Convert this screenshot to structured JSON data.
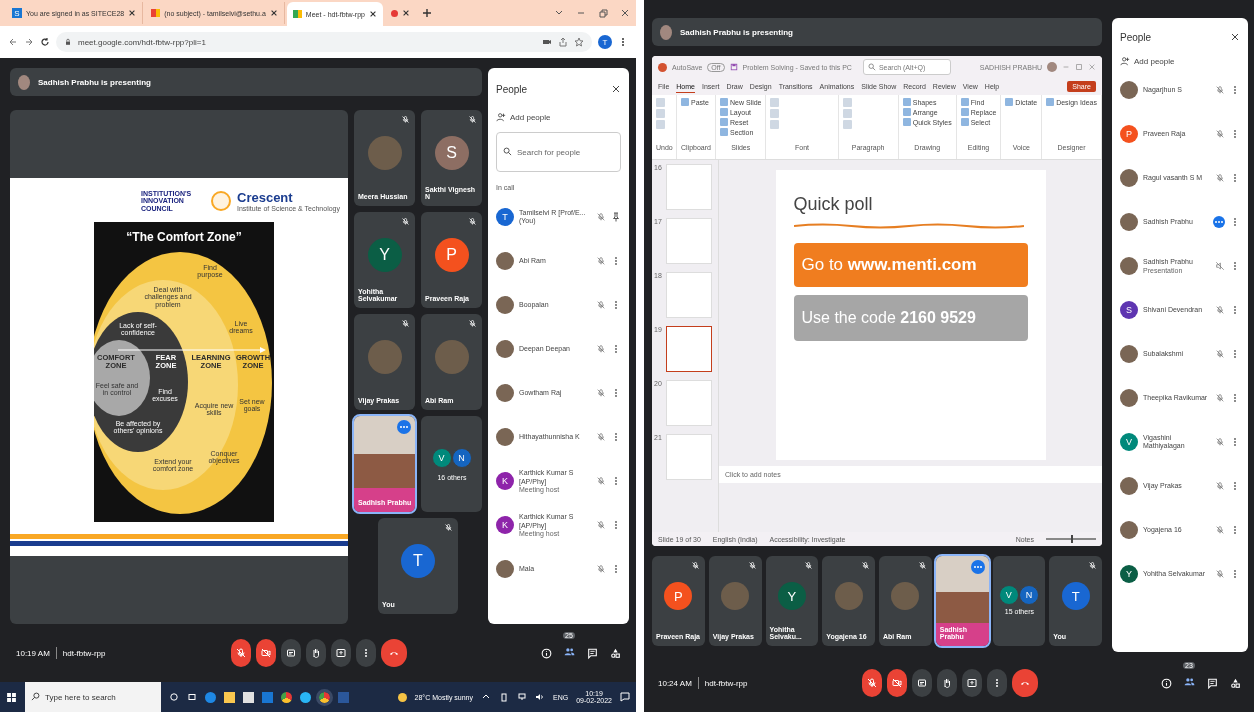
{
  "left": {
    "browser": {
      "tabs": [
        {
          "title": "You are signed in as SITECE28",
          "favicon": "S",
          "selected": false
        },
        {
          "title": "(no subject) - tamilselvi@sethu.a",
          "selected": false
        },
        {
          "title": "Meet - hdt-fbtw-rpp",
          "selected": true
        }
      ],
      "recording_tab": true,
      "url": "meet.google.com/hdt-fbtw-rpp?pli=1",
      "profile": "T"
    },
    "meet": {
      "banner": "Sadhish Prabhu is presenting",
      "slide": {
        "logo_left": "INSTITUTION'S INNOVATION COUNCIL",
        "logo_right": "Crescent",
        "logo_right_sub": "Institute of Science & Technology",
        "title": "“The Comfort Zone”",
        "labels": [
          {
            "text": "Find purpose",
            "kind": "note"
          },
          {
            "text": "Deal with challenges and problem",
            "kind": "note"
          },
          {
            "text": "Lack of self-confidence",
            "kind": "inner"
          },
          {
            "text": "Live dreams",
            "kind": "note"
          },
          {
            "text": "COMFORT ZONE",
            "kind": "zone_dark"
          },
          {
            "text": "FEAR ZONE",
            "kind": "zone"
          },
          {
            "text": "LEARNING ZONE",
            "kind": "zone_dark"
          },
          {
            "text": "GROWTH ZONE",
            "kind": "zone_dark"
          },
          {
            "text": "Feel safe and in control",
            "kind": "note"
          },
          {
            "text": "Find excuses",
            "kind": "inner"
          },
          {
            "text": "Be affected by others' opinions",
            "kind": "inner"
          },
          {
            "text": "Acquire new skills",
            "kind": "note"
          },
          {
            "text": "Set new goals",
            "kind": "note"
          },
          {
            "text": "Extend your comfort zone",
            "kind": "note"
          },
          {
            "text": "Conquer objectives",
            "kind": "note"
          }
        ]
      },
      "tiles": [
        {
          "name": "Meera Hussian",
          "kind": "photo",
          "muted": true
        },
        {
          "name": "Sakthi Vignesh N",
          "kind": "letter",
          "letter": "S",
          "color": "#8d6e63",
          "muted": true
        },
        {
          "name": "Yohitha Selvakumar",
          "kind": "letter",
          "letter": "Y",
          "color": "#0b5e45",
          "muted": true
        },
        {
          "name": "Praveen Raja",
          "kind": "letter",
          "letter": "P",
          "color": "#f4511e",
          "muted": true
        },
        {
          "name": "Vijay Prakas",
          "kind": "photo",
          "muted": true
        },
        {
          "name": "Abi Ram",
          "kind": "photo",
          "muted": true
        },
        {
          "name": "Sadhish Prabhu",
          "kind": "video",
          "muted": false
        },
        {
          "name": "16 others",
          "kind": "others",
          "muted": false,
          "letters": [
            {
              "letter": "V",
              "color": "#00897b"
            },
            {
              "letter": "N",
              "color": "#1565c0"
            }
          ]
        },
        {
          "name": "You",
          "kind": "letter",
          "letter": "T",
          "color": "#1967d2",
          "muted": true
        }
      ],
      "people": {
        "title": "People",
        "add": "Add people",
        "search_placeholder": "Search for people",
        "section": "In call",
        "rows": [
          {
            "name": "Tamilselvi R [Prof/E...",
            "tag": "(You)",
            "letter": "T",
            "color": "#1967d2",
            "kind": "muted",
            "pin": true
          },
          {
            "name": "Abi Ram",
            "kind": "muted",
            "pin": false
          },
          {
            "name": "Boopalan",
            "kind": "muted",
            "pin": false
          },
          {
            "name": "Deepan Deepan",
            "kind": "muted",
            "pin": false
          },
          {
            "name": "Gowtham Raj",
            "kind": "muted",
            "pin": false
          },
          {
            "name": "Hithayathunnisha K",
            "kind": "muted",
            "pin": false
          },
          {
            "name": "Karthick Kumar S [AP/Phy]",
            "sub": "Meeting host",
            "letter": "K",
            "color": "#8e24aa",
            "kind": "muted",
            "pin": false
          },
          {
            "name": "Karthick Kumar S [AP/Phy]",
            "sub": "Meeting host",
            "letter": "K",
            "color": "#8e24aa",
            "kind": "muted",
            "pin": false
          },
          {
            "name": "Mala",
            "kind": "muted",
            "pin": false
          }
        ]
      },
      "bar": {
        "time": "10:19 AM",
        "code": "hdt-fbtw-rpp",
        "mic_on": false,
        "camera_on": false,
        "people_count": "25"
      }
    },
    "taskbar": {
      "search_placeholder": "Type here to search",
      "weather": "28°C Mostly sunny",
      "lang": "ENG",
      "time": "10:19",
      "date": "09-02-2022"
    }
  },
  "right": {
    "banner": "Sadhish Prabhu is presenting",
    "ppt": {
      "autosave": "AutoSave",
      "autosave_state": "Off",
      "doc": "Problem Solving - Saved to this PC",
      "search": "Search (Alt+Q)",
      "user": "SADHISH PRABHU",
      "tabs": [
        {
          "label": "File",
          "selected": false
        },
        {
          "label": "Home",
          "selected": true
        },
        {
          "label": "Insert",
          "selected": false
        },
        {
          "label": "Draw",
          "selected": false
        },
        {
          "label": "Design",
          "selected": false
        },
        {
          "label": "Transitions",
          "selected": false
        },
        {
          "label": "Animations",
          "selected": false
        },
        {
          "label": "Slide Show",
          "selected": false
        },
        {
          "label": "Record",
          "selected": false
        },
        {
          "label": "Review",
          "selected": false
        },
        {
          "label": "View",
          "selected": false
        },
        {
          "label": "Help",
          "selected": false
        }
      ],
      "share": "Share",
      "groups": [
        {
          "label": "Undo"
        },
        {
          "label": "Clipboard",
          "items": [
            "Paste"
          ]
        },
        {
          "label": "Slides",
          "items": [
            "New Slide",
            "Layout",
            "Reset",
            "Section"
          ]
        },
        {
          "label": "Font"
        },
        {
          "label": "Paragraph"
        },
        {
          "label": "Drawing",
          "items": [
            "Shapes",
            "Arrange",
            "Quick Styles"
          ]
        },
        {
          "label": "Editing",
          "items": [
            "Find",
            "Replace",
            "Select"
          ]
        },
        {
          "label": "Voice",
          "items": [
            "Dictate"
          ]
        },
        {
          "label": "Designer",
          "items": [
            "Design Ideas"
          ]
        }
      ],
      "thumbnails": [
        {
          "number": "16",
          "selected": false
        },
        {
          "number": "17",
          "selected": false
        },
        {
          "number": "18",
          "selected": false
        },
        {
          "number": "19",
          "selected": true
        },
        {
          "number": "20",
          "selected": false
        },
        {
          "number": "21",
          "selected": false
        }
      ],
      "slide": {
        "title": "Quick poll",
        "link_box": "Go to **www.menti.com**",
        "code_box": "Use the code **2160 9529**"
      },
      "notes": "Click to add notes",
      "status": {
        "slide": "Slide 19 of 30",
        "language": "English (India)",
        "accessibility": "Accessibility: Investigate",
        "notes": "Notes",
        "zoom": {
          "level": 0.5
        }
      }
    },
    "tiles": [
      {
        "name": "Praveen Raja",
        "kind": "letter",
        "letter": "P",
        "color": "#f4511e",
        "muted": true
      },
      {
        "name": "Vijay Prakas",
        "kind": "photo",
        "muted": true
      },
      {
        "name": "Yohitha Selvaku...",
        "kind": "letter",
        "letter": "Y",
        "color": "#0b5e45",
        "muted": true
      },
      {
        "name": "Yogajena 16",
        "kind": "photo",
        "muted": true
      },
      {
        "name": "Abi Ram",
        "kind": "photo",
        "muted": true
      },
      {
        "name": "Sadhish Prabhu",
        "kind": "video",
        "muted": false
      },
      {
        "name": "15 others",
        "kind": "others",
        "muted": false,
        "letters": [
          {
            "letter": "V",
            "color": "#00897b"
          },
          {
            "letter": "N",
            "color": "#1565c0"
          }
        ]
      },
      {
        "name": "You",
        "kind": "letter",
        "letter": "T",
        "color": "#1967d2",
        "muted": true
      }
    ],
    "people": {
      "title": "People",
      "add": "Add people",
      "rows": [
        {
          "name": "Nagarjhun S",
          "kind": "muted",
          "pin": false
        },
        {
          "name": "Praveen Raja",
          "letter": "P",
          "color": "#f4511e",
          "kind": "muted",
          "pin": false
        },
        {
          "name": "Ragul vasanth S M",
          "kind": "muted",
          "pin": false
        },
        {
          "name": "Sadhish Prabhu",
          "kind": "speaking",
          "pin": false
        },
        {
          "name": "Sadhish Prabhu",
          "sub": "Presentation",
          "kind": "presentation",
          "pin": false
        },
        {
          "name": "Shivani Devendran",
          "letter": "S",
          "color": "#5e35b1",
          "kind": "muted",
          "pin": false
        },
        {
          "name": "Subalakshmi",
          "kind": "muted",
          "pin": false
        },
        {
          "name": "Theepika Ravikumar",
          "kind": "muted",
          "pin": false
        },
        {
          "name": "Vigashini Mathiyalagan",
          "letter": "V",
          "color": "#00897b",
          "kind": "muted",
          "pin": false
        },
        {
          "name": "Vijay Prakas",
          "kind": "muted",
          "pin": false
        },
        {
          "name": "Yogajena 16",
          "kind": "muted",
          "pin": false
        },
        {
          "name": "Yohitha Selvakumar",
          "letter": "Y",
          "color": "#0b5e45",
          "kind": "muted",
          "pin": false
        }
      ]
    },
    "bar": {
      "time": "10:24 AM",
      "code": "hdt-fbtw-rpp",
      "mic_on": false,
      "camera_on": false,
      "people_count": "23"
    }
  }
}
